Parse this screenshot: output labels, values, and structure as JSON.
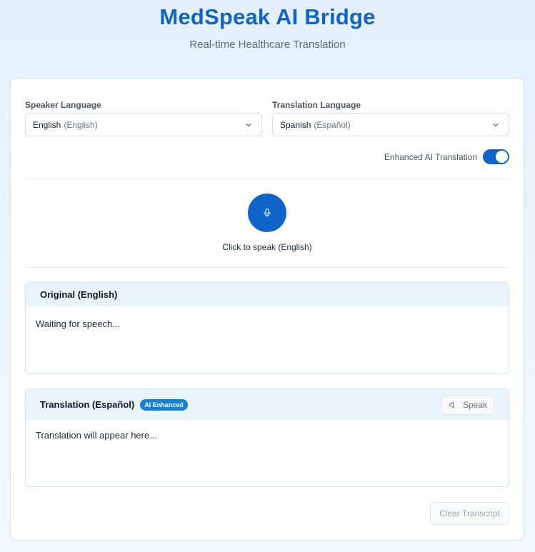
{
  "header": {
    "title": "MedSpeak AI Bridge",
    "subtitle": "Real-time Healthcare Translation"
  },
  "speaker_language": {
    "label": "Speaker Language",
    "selected": "English",
    "native": "(English)",
    "icon": "chevron-down-icon"
  },
  "translation_language": {
    "label": "Translation Language",
    "selected": "Spanish",
    "native": "(Español)",
    "icon": "chevron-down-icon"
  },
  "enhanced_toggle": {
    "label": "Enhanced AI Translation",
    "on": true,
    "color": "#0f63c9"
  },
  "mic": {
    "icon": "microphone-icon",
    "caption": "Click to speak (English)",
    "color": "#0f63c9"
  },
  "original_panel": {
    "title": "Original (English)",
    "text": "Waiting for speech..."
  },
  "translation_panel": {
    "title": "Translation (Español)",
    "badge": "AI Enhanced",
    "speak_label": "Speak",
    "speak_icon": "speaker-icon",
    "text": "Translation will appear here..."
  },
  "actions": {
    "clear_label": "Clear Transcript"
  },
  "colors": {
    "accent": "#0f63c9",
    "badge": "#1581d6",
    "panel_header": "#e8f3fc"
  }
}
